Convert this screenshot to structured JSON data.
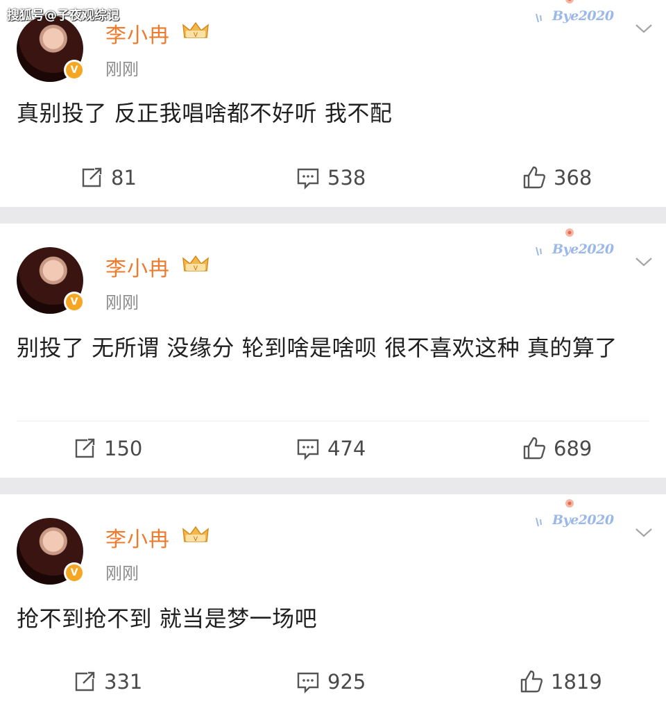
{
  "watermark": "搜狐号@子夜观综记",
  "sticker_text": "Bye2020",
  "colors": {
    "name": "#ef7a2b",
    "verified": "#f5a623",
    "text": "#1f1f1f",
    "meta": "#8b8b8b"
  },
  "posts": [
    {
      "username": "李小冉",
      "time": "刚刚",
      "content": "真别投了 反正我唱啥都不好听 我不配",
      "reposts": "81",
      "comments": "538",
      "likes": "368"
    },
    {
      "username": "李小冉",
      "time": "刚刚",
      "content": "别投了 无所谓 没缘分 轮到啥是啥呗 很不喜欢这种 真的算了",
      "reposts": "150",
      "comments": "474",
      "likes": "689"
    },
    {
      "username": "李小冉",
      "time": "刚刚",
      "content": "抢不到抢不到 就当是梦一场吧",
      "reposts": "331",
      "comments": "925",
      "likes": "1819"
    }
  ],
  "icons": {
    "repost": "repost-icon",
    "comment": "comment-icon",
    "like": "like-icon",
    "more": "chevron-down-icon",
    "badge": "verified-badge-icon",
    "crown": "crown-icon"
  }
}
